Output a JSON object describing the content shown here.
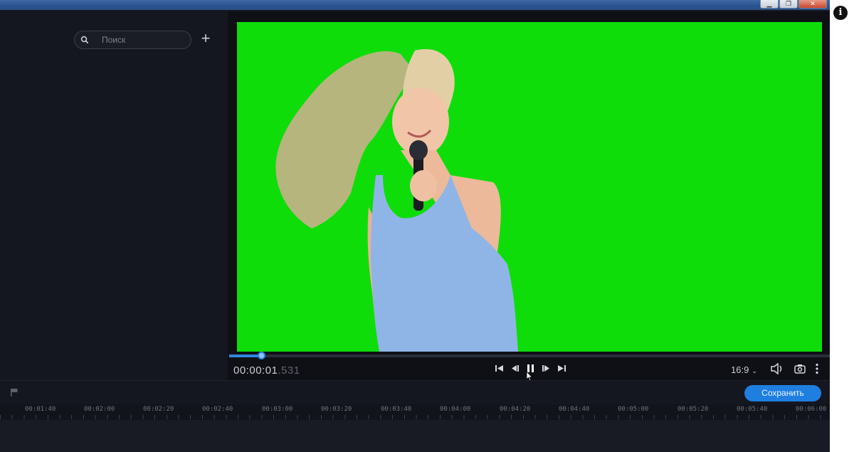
{
  "window": {
    "controls": [
      "minimize",
      "restore",
      "close"
    ],
    "close_glyph": "✕",
    "min_glyph": "▁",
    "restore_glyph": "❐"
  },
  "media_panel": {
    "search_placeholder": "Поиск",
    "add_label": "+"
  },
  "player": {
    "timecode_main": "00:00:01",
    "timecode_frac": ".531",
    "progress": 0.054,
    "aspect_ratio": "16:9",
    "controls": [
      "skip-to-start-icon",
      "previous-frame-icon",
      "pause-icon",
      "next-frame-icon",
      "skip-to-end-icon"
    ]
  },
  "timeline": {
    "save_label": "Сохранить",
    "ruler_labels": [
      "00:01:40",
      "00:02:00",
      "00:02:20",
      "00:02:40",
      "00:03:00",
      "00:03:20",
      "00:03:40",
      "00:04:00",
      "00:04:20",
      "00:04:40",
      "00:05:00",
      "00:05:20",
      "00:05:40",
      "00:06:00"
    ]
  },
  "colors": {
    "chroma_green": "#0edd0a",
    "accent_blue": "#1f7fe0",
    "background": "#151821"
  }
}
